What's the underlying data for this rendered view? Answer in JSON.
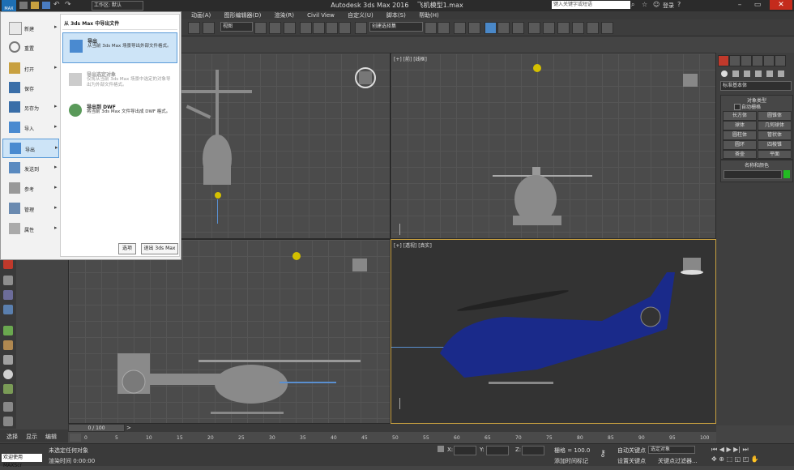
{
  "window": {
    "title": "Autodesk 3ds Max 2016",
    "file": "飞机模型1.max",
    "search_placeholder": "键入关键字或短语",
    "login": "登录",
    "app_button": "MAX"
  },
  "quick_access": {
    "workspace": "工作区: 默认"
  },
  "menubar": {
    "items": [
      "动画(A)",
      "图形编辑器(D)",
      "渲染(R)",
      "Civil View",
      "自定义(U)",
      "脚本(S)",
      "帮助(H)"
    ]
  },
  "toolbar": {
    "view_select": "视图",
    "selection_set": "创建选择集"
  },
  "app_menu": {
    "left_items": [
      {
        "label": "新建",
        "arrow": true
      },
      {
        "label": "重置",
        "arrow": false
      },
      {
        "label": "打开",
        "arrow": true
      },
      {
        "label": "保存",
        "arrow": false
      },
      {
        "label": "另存为",
        "arrow": true
      },
      {
        "label": "导入",
        "arrow": true
      },
      {
        "label": "导出",
        "arrow": true
      },
      {
        "label": "发送到",
        "arrow": true
      },
      {
        "label": "参考",
        "arrow": true
      },
      {
        "label": "管理",
        "arrow": true
      },
      {
        "label": "属性",
        "arrow": true
      }
    ],
    "panel_title": "从 3ds Max 中导出文件",
    "options": [
      {
        "title": "导出",
        "desc": "从当前 3ds Max 场景导出外部文件格式。"
      },
      {
        "title": "导出选定对象",
        "desc": "仅将从当前 3ds Max 场景中选定的对象导出为外部文件格式。"
      },
      {
        "title": "导出到 DWF",
        "desc": "将当前 3ds Max 文件导出成 DWF 格式。"
      }
    ],
    "options_button": "选项",
    "exit_button": "退出 3ds Max"
  },
  "viewports": {
    "top_right": "[+] [前] [线框]",
    "bottom_right": "[+] [透视] [真实]"
  },
  "command_panel": {
    "category": "标准基本体",
    "object_type_title": "对象类型",
    "autogrid": "自动栅格",
    "buttons": [
      "长方体",
      "圆锥体",
      "球体",
      "几何球体",
      "圆柱体",
      "管状体",
      "圆环",
      "四棱锥",
      "茶壶",
      "平面"
    ],
    "name_color_title": "名称和颜色",
    "color": "#22bb22"
  },
  "timeline": {
    "frame_counter": "0 / 100",
    "ticks": [
      "0",
      "5",
      "10",
      "15",
      "20",
      "25",
      "30",
      "35",
      "40",
      "45",
      "50",
      "55",
      "60",
      "65",
      "70",
      "75",
      "80",
      "85",
      "90",
      "95",
      "100"
    ]
  },
  "statusbar": {
    "tabs": [
      "选择",
      "显示",
      "编辑"
    ],
    "welcome": "欢迎使用 MAXScr",
    "status1": "未选定任何对象",
    "status2": "渲染时间 0:00:00",
    "x_label": "X:",
    "y_label": "Y:",
    "z_label": "Z:",
    "grid": "栅格 = 100.0",
    "add_time_tag": "添加时间标记",
    "auto_key": "自动关键点",
    "set_key": "设置关键点",
    "selected": "选定对象",
    "key_filters": "关键点过滤器..."
  }
}
